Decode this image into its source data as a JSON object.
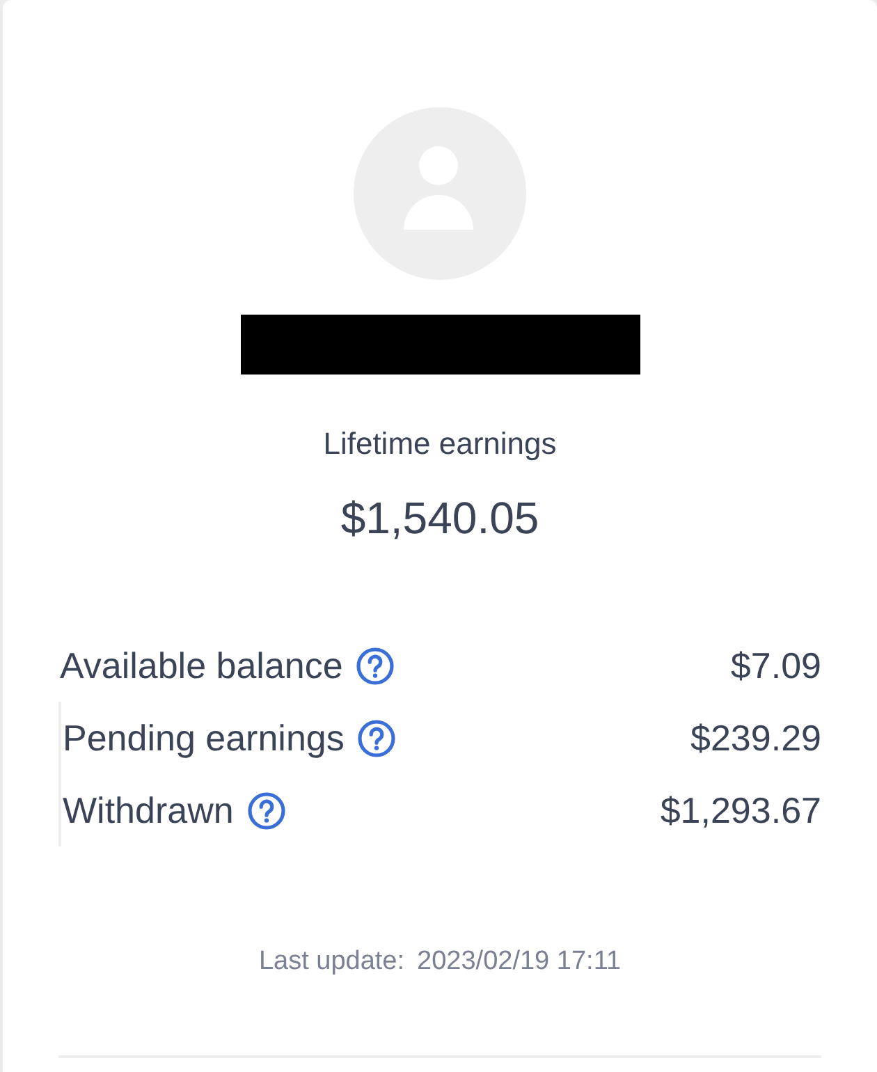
{
  "summary": {
    "label": "Lifetime earnings",
    "amount": "$1,540.05"
  },
  "balances": [
    {
      "label": "Available balance",
      "value": "$7.09",
      "help": true
    },
    {
      "label": "Pending earnings",
      "value": "$239.29",
      "help": true
    },
    {
      "label": "Withdrawn",
      "value": "$1,293.67",
      "help": true
    }
  ],
  "footer": {
    "label": "Last update:",
    "timestamp": "2023/02/19 17:11"
  }
}
